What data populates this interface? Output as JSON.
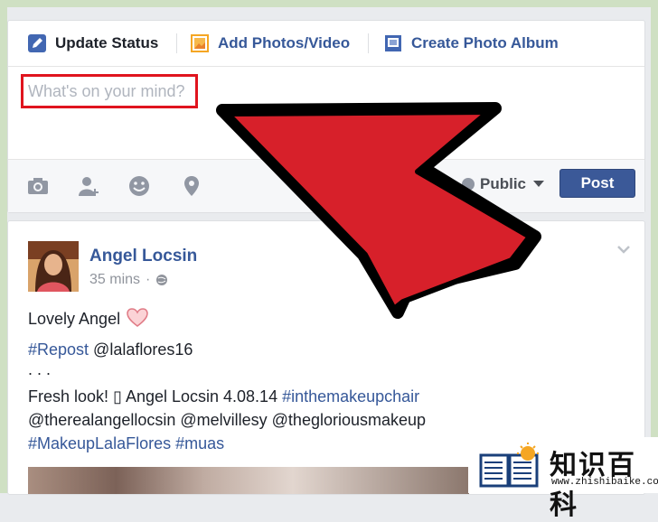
{
  "composer": {
    "tabs": [
      {
        "label": "Update Status",
        "icon": "pencil-icon",
        "color": "#1d2129"
      },
      {
        "label": "Add Photos/Video",
        "icon": "photo-icon",
        "color": "#365899"
      },
      {
        "label": "Create Photo Album",
        "icon": "album-icon",
        "color": "#365899"
      }
    ],
    "placeholder": "What's on your mind?",
    "toolbar_icons": [
      "camera-icon",
      "tag-people-icon",
      "feeling-icon",
      "location-icon"
    ],
    "audience_label": "Public",
    "post_label": "Post"
  },
  "post": {
    "author": "Angel Locsin",
    "time": "35 mins",
    "lines": [
      {
        "text": "Lovely Angel"
      },
      {
        "hashtag": "#Repost",
        "rest": " @lalaflores16"
      },
      {
        "text": ". . ."
      },
      {
        "pre": "Fresh look! ▯ Angel Locsin 4.08.14 ",
        "hashtag": "#inthemakeupchair"
      },
      {
        "text": "@therealangellocsin @melvillesy @thegloriousmakeup"
      },
      {
        "hashtag": "#MakeupLalaFlores",
        "hashtag2": "#muas"
      }
    ]
  },
  "watermark": {
    "title": "知识百科",
    "url": "www.zhishibaike.com"
  },
  "colors": {
    "brand": "#3b5998",
    "link": "#365899",
    "highlight": "#e0141e",
    "arrow": "#d7202a"
  }
}
